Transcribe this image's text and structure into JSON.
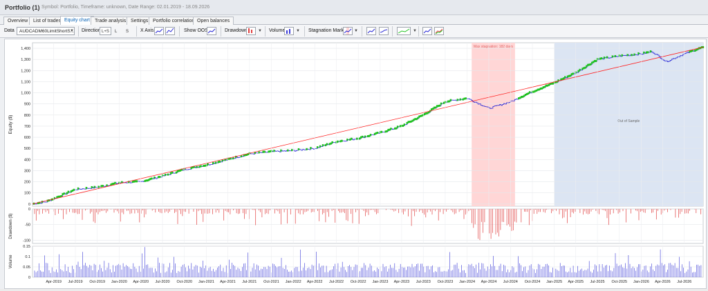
{
  "window": {
    "title": "Portfolio (1)",
    "subtitle": "Symbol: Portfolio, Timeframe: unknown, Date Range: 02.01.2019 - 18.09.2026"
  },
  "tabs": [
    {
      "label": "Overview",
      "active": false
    },
    {
      "label": "List of trades",
      "active": false
    },
    {
      "label": "Equity chart",
      "active": true
    },
    {
      "label": "Trade analysis",
      "active": false
    },
    {
      "label": "Settings",
      "active": false
    },
    {
      "label": "Portfolio correlation",
      "active": false
    },
    {
      "label": "Open balances",
      "active": false
    }
  ],
  "toolbar": {
    "data_label": "Data",
    "data_value": "AUDCADM60LimitShortS...",
    "direction_label": "Direction",
    "direction_options": [
      "L+S",
      "L",
      "S"
    ],
    "direction_selected": "L+S",
    "xaxis_label": "X Axis",
    "show_oos_label": "Show OOS",
    "drawdown_label": "Drawdown",
    "volume_label": "Volume",
    "stagnation_label": "Stagnation Marker"
  },
  "colors": {
    "equity_line": "#2b2bd6",
    "new_high": "#1ec21e",
    "trend_line": "#ff2020",
    "stagnation_fill": "#ffd6d6",
    "oos_fill": "#dce5f3",
    "drawdown_bar": "#e04040",
    "volume_bar": "#3a3ad8"
  },
  "chart_data": [
    {
      "type": "line",
      "ylabel": "Equity ($)",
      "ylim": [
        -20,
        1450
      ],
      "yticks": [
        0,
        100,
        200,
        300,
        400,
        500,
        600,
        700,
        800,
        900,
        1000,
        1100,
        1200,
        1300,
        1400
      ],
      "xticks": [
        "Apr-2019",
        "Jul-2019",
        "Oct-2019",
        "Jan-2020",
        "Apr-2020",
        "Jul-2020",
        "Oct-2020",
        "Jan-2021",
        "Apr-2021",
        "Jul-2021",
        "Oct-2021",
        "Jan-2022",
        "Apr-2022",
        "Jul-2022",
        "Oct-2022",
        "Jan-2023",
        "Apr-2023",
        "Jul-2023",
        "Oct-2023",
        "Jan-2024",
        "Apr-2024",
        "Jul-2024",
        "Oct-2024",
        "Jan-2025",
        "Apr-2025",
        "Jul-2025",
        "Oct-2025",
        "Jan-2026",
        "Apr-2026",
        "Jul-2026"
      ],
      "x_start": "2019-01-02",
      "x_end": "2026-09-18",
      "series": [
        {
          "values": [
            {
              "x": "2019-01-02",
              "y": 0
            },
            {
              "x": "2019-03-01",
              "y": 20
            },
            {
              "x": "2019-04-15",
              "y": 60
            },
            {
              "x": "2019-07-01",
              "y": 130
            },
            {
              "x": "2019-10-01",
              "y": 150
            },
            {
              "x": "2020-01-01",
              "y": 190
            },
            {
              "x": "2020-04-01",
              "y": 200
            },
            {
              "x": "2020-07-01",
              "y": 250
            },
            {
              "x": "2020-10-01",
              "y": 310
            },
            {
              "x": "2021-01-01",
              "y": 350
            },
            {
              "x": "2021-04-01",
              "y": 400
            },
            {
              "x": "2021-07-01",
              "y": 450
            },
            {
              "x": "2021-10-01",
              "y": 470
            },
            {
              "x": "2022-01-01",
              "y": 480
            },
            {
              "x": "2022-04-01",
              "y": 500
            },
            {
              "x": "2022-07-01",
              "y": 560
            },
            {
              "x": "2022-10-01",
              "y": 590
            },
            {
              "x": "2023-01-01",
              "y": 640
            },
            {
              "x": "2023-04-01",
              "y": 700
            },
            {
              "x": "2023-07-01",
              "y": 800
            },
            {
              "x": "2023-10-01",
              "y": 920
            },
            {
              "x": "2024-01-01",
              "y": 950
            },
            {
              "x": "2024-04-01",
              "y": 860
            },
            {
              "x": "2024-07-01",
              "y": 920
            },
            {
              "x": "2024-10-01",
              "y": 1010
            },
            {
              "x": "2025-01-01",
              "y": 1090
            },
            {
              "x": "2025-04-01",
              "y": 1180
            },
            {
              "x": "2025-07-01",
              "y": 1300
            },
            {
              "x": "2025-10-01",
              "y": 1330
            },
            {
              "x": "2026-01-01",
              "y": 1350
            },
            {
              "x": "2026-02-15",
              "y": 1370
            },
            {
              "x": "2026-04-15",
              "y": 1280
            },
            {
              "x": "2026-07-01",
              "y": 1350
            },
            {
              "x": "2026-09-18",
              "y": 1410
            }
          ]
        },
        {
          "values": [
            {
              "x": "2019-01-02",
              "y": 0
            },
            {
              "x": "2026-09-18",
              "y": 1410
            }
          ]
        }
      ],
      "annotations": [
        {
          "label": "Max stagnation: 182 days",
          "from": "2024-01-20",
          "to": "2024-07-20"
        },
        {
          "label": "Out of Sample",
          "from": "2025-01-01",
          "to": "2026-09-18"
        }
      ],
      "grid": true
    },
    {
      "type": "bar",
      "ylabel": "Drawdown ($)",
      "ylim": [
        -110,
        0
      ],
      "yticks": [
        0,
        -50,
        -100
      ]
    },
    {
      "type": "bar",
      "ylabel": "Volume",
      "ylim": [
        0,
        0.15
      ],
      "yticks": [
        0,
        0.05,
        0.1,
        0.15
      ]
    }
  ]
}
